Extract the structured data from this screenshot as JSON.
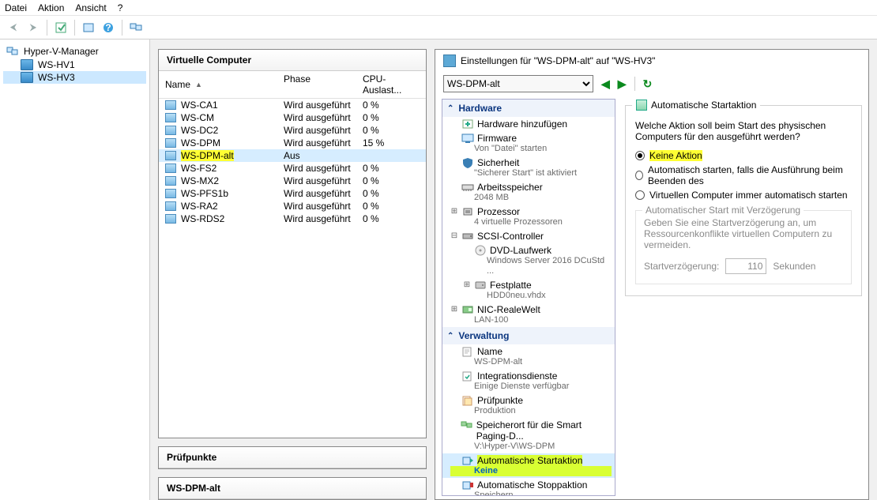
{
  "menu": {
    "items": [
      "Datei",
      "Aktion",
      "Ansicht",
      "?"
    ]
  },
  "nav": {
    "root": "Hyper-V-Manager",
    "hosts": [
      "WS-HV1",
      "WS-HV3"
    ],
    "selectedIndex": 1
  },
  "vmPanel": {
    "title": "Virtuelle Computer",
    "columns": {
      "name": "Name",
      "phase": "Phase",
      "cpu": "CPU-Auslast..."
    },
    "rows": [
      {
        "name": "WS-CA1",
        "phase": "Wird ausgeführt",
        "cpu": "0 %"
      },
      {
        "name": "WS-CM",
        "phase": "Wird ausgeführt",
        "cpu": "0 %"
      },
      {
        "name": "WS-DC2",
        "phase": "Wird ausgeführt",
        "cpu": "0 %"
      },
      {
        "name": "WS-DPM",
        "phase": "Wird ausgeführt",
        "cpu": "15 %"
      },
      {
        "name": "WS-DPM-alt",
        "phase": "Aus",
        "cpu": "",
        "selected": true,
        "hiliteName": true
      },
      {
        "name": "WS-FS2",
        "phase": "Wird ausgeführt",
        "cpu": "0 %"
      },
      {
        "name": "WS-MX2",
        "phase": "Wird ausgeführt",
        "cpu": "0 %"
      },
      {
        "name": "WS-PFS1b",
        "phase": "Wird ausgeführt",
        "cpu": "0 %"
      },
      {
        "name": "WS-RA2",
        "phase": "Wird ausgeführt",
        "cpu": "0 %"
      },
      {
        "name": "WS-RDS2",
        "phase": "Wird ausgeführt",
        "cpu": "0 %"
      }
    ],
    "checkpoints": "Prüfpunkte",
    "selectedVmHeader": "WS-DPM-alt"
  },
  "settings": {
    "title": "Einstellungen für \"WS-DPM-alt\" auf \"WS-HV3\"",
    "vmSelect": "WS-DPM-alt",
    "groups": {
      "hardware": "Hardware",
      "management": "Verwaltung"
    },
    "tree": {
      "hardware": [
        {
          "label": "Hardware hinzufügen"
        },
        {
          "label": "Firmware",
          "sub": "Von \"Datei\" starten"
        },
        {
          "label": "Sicherheit",
          "sub": "\"Sicherer Start\" ist aktiviert"
        },
        {
          "label": "Arbeitsspeicher",
          "sub": "2048 MB"
        },
        {
          "label": "Prozessor",
          "sub": "4 virtuelle Prozessoren",
          "expander": "+"
        },
        {
          "label": "SCSI-Controller",
          "expander": "-",
          "children": [
            {
              "label": "DVD-Laufwerk",
              "sub": "Windows Server 2016 DCuStd ..."
            },
            {
              "label": "Festplatte",
              "sub": "HDD0neu.vhdx",
              "expander": "+"
            }
          ]
        },
        {
          "label": "NIC-RealeWelt",
          "sub": "LAN-100",
          "expander": "+"
        }
      ],
      "management": [
        {
          "label": "Name",
          "sub": "WS-DPM-alt"
        },
        {
          "label": "Integrationsdienste",
          "sub": "Einige Dienste verfügbar"
        },
        {
          "label": "Prüfpunkte",
          "sub": "Produktion"
        },
        {
          "label": "Speicherort für die Smart Paging-D...",
          "sub": "V:\\Hyper-V\\WS-DPM"
        },
        {
          "label": "Automatische Startaktion",
          "sub": "Keine",
          "selected": true,
          "hilite": true
        },
        {
          "label": "Automatische Stoppaktion",
          "sub": "Speichern"
        }
      ]
    },
    "page": {
      "legend": "Automatische Startaktion",
      "question": "Welche Aktion soll beim Start des physischen Computers für den ausgeführt werden?",
      "options": [
        {
          "label": "Keine Aktion",
          "checked": true,
          "hilite": true
        },
        {
          "label": "Automatisch starten, falls die Ausführung beim Beenden des",
          "checked": false
        },
        {
          "label": "Virtuellen Computer immer automatisch starten",
          "checked": false
        }
      ],
      "delayGroup": {
        "legend": "Automatischer Start mit Verzögerung",
        "hint": "Geben Sie eine Startverzögerung an, um Ressourcenkonflikte virtuellen Computern zu vermeiden.",
        "label": "Startverzögerung:",
        "value": "110",
        "unit": "Sekunden"
      }
    }
  }
}
